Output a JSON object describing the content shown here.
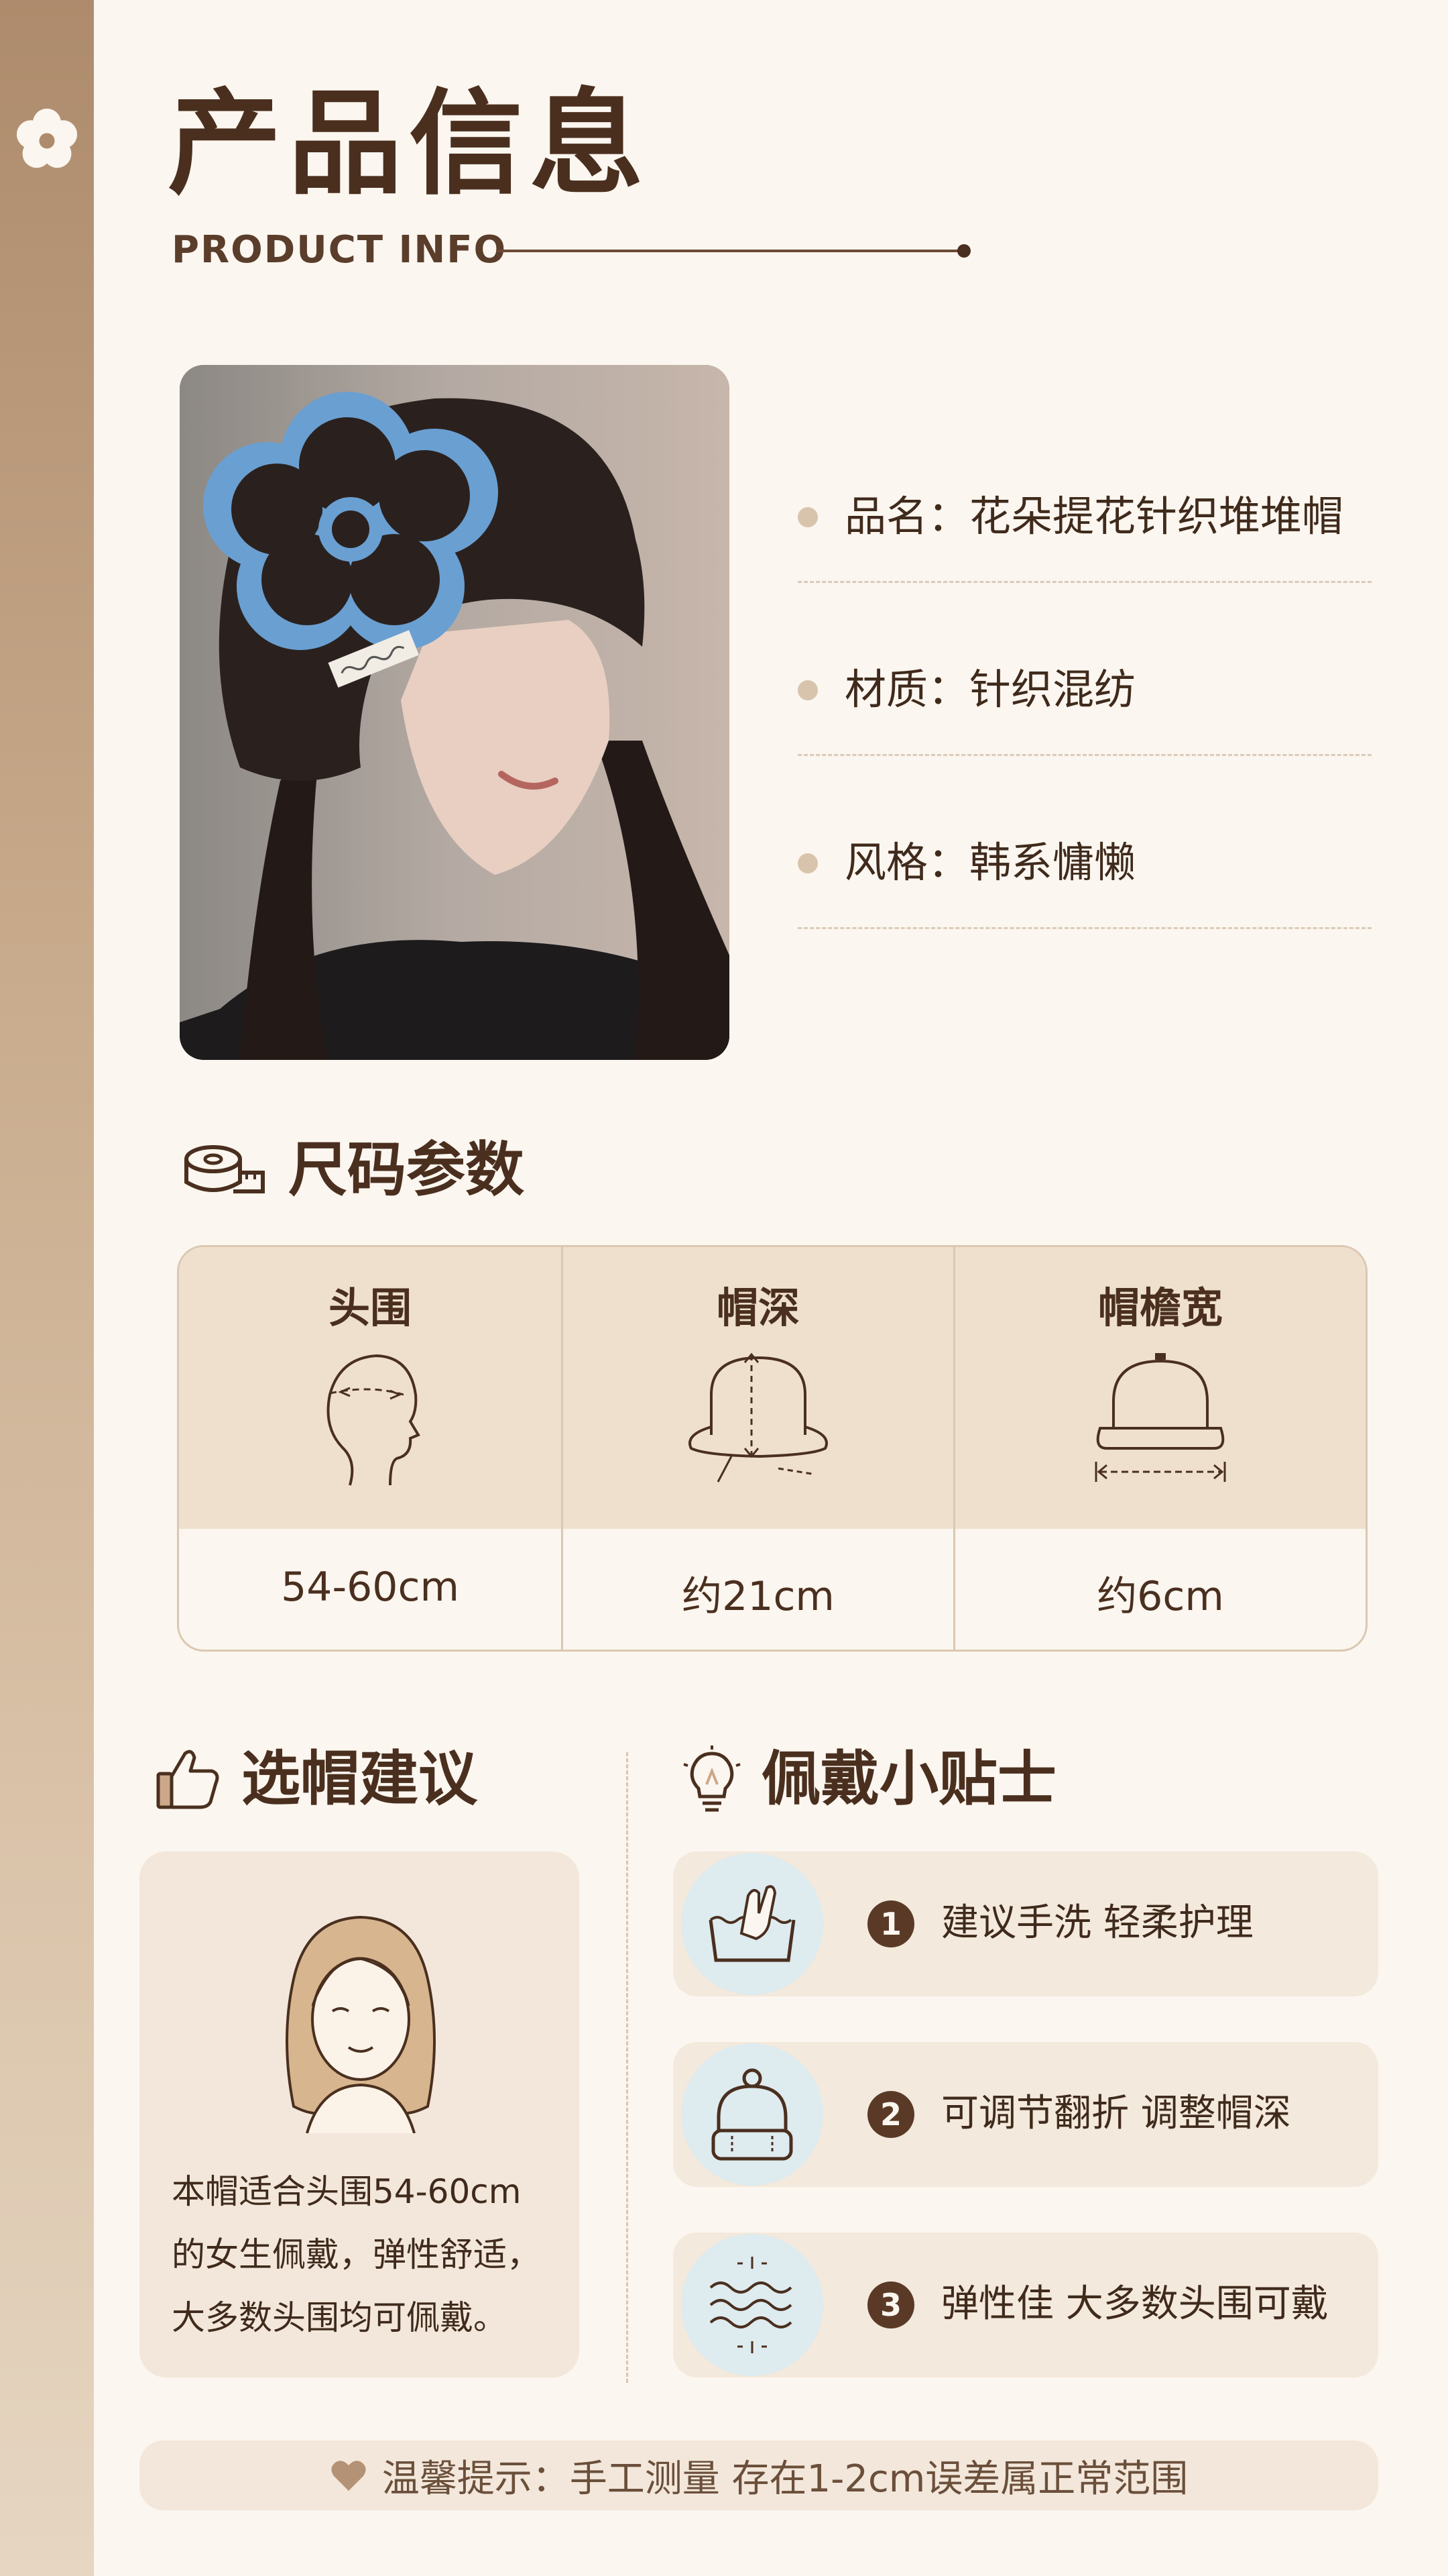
{
  "header": {
    "title_cn": "产品信息",
    "title_en": "PRODUCT INFO"
  },
  "product_info": {
    "items": [
      {
        "label": "品名",
        "value": "花朵提花针织堆堆帽",
        "text": "品名：花朵提花针织堆堆帽"
      },
      {
        "label": "材质",
        "value": "针织混纺",
        "text": "材质：针织混纺"
      },
      {
        "label": "风格",
        "value": "韩系慵懒",
        "text": "风格：韩系慵懒"
      }
    ]
  },
  "size_params": {
    "title": "尺码参数",
    "columns": [
      {
        "label": "头围",
        "value": "54-60cm",
        "icon": "head-outline-icon"
      },
      {
        "label": "帽深",
        "value": "约21cm",
        "icon": "hat-depth-icon"
      },
      {
        "label": "帽檐宽",
        "value": "约6cm",
        "icon": "hat-brim-width-icon"
      }
    ]
  },
  "recommendation": {
    "title": "选帽建议",
    "icon": "thumbs-up-icon",
    "lines": [
      "本帽适合头围54-60cm",
      "的女生佩戴，弹性舒适，",
      "大多数头围均可佩戴。"
    ]
  },
  "wearing_tips": {
    "title": "佩戴小贴士",
    "icon": "lightbulb-icon",
    "items": [
      {
        "num": "1",
        "text": "建议手洗 轻柔护理",
        "icon": "hand-wash-icon"
      },
      {
        "num": "2",
        "text": "可调节翻折 调整帽深",
        "icon": "beanie-hat-icon"
      },
      {
        "num": "3",
        "text": "弹性佳 大多数头围可戴",
        "icon": "stretch-waves-icon"
      }
    ]
  },
  "footer": {
    "text": "温馨提示：手工测量 存在1-2cm误差属正常范围",
    "icon": "heart-icon"
  },
  "colors": {
    "background": "#fbf6ef",
    "accent_brown": "#4a2f1f",
    "side_strip": "#ad8b6c",
    "table_header": "#eee0cd",
    "tip_circle": "#deebef",
    "hat_pattern_blue": "#6a9fd2"
  }
}
